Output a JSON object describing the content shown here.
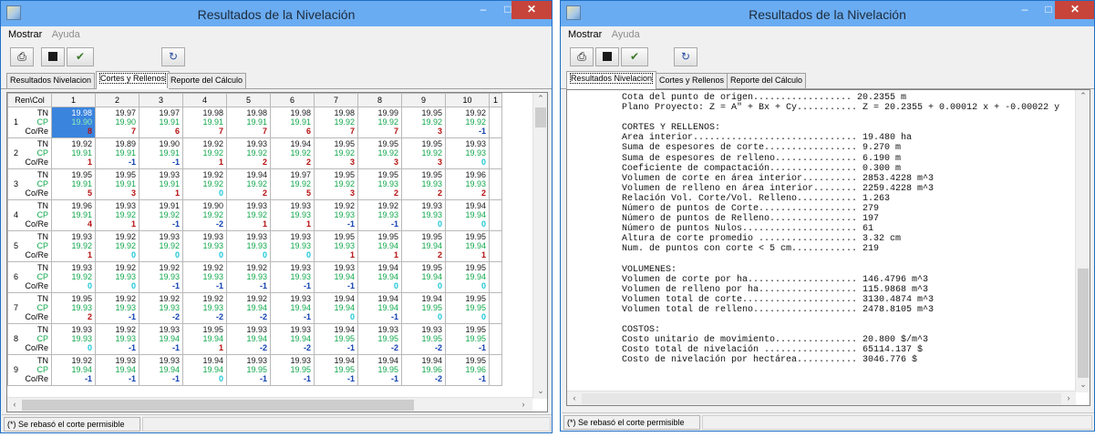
{
  "window_a": {
    "title": "Resultados de la Nivelación",
    "menu": [
      "Mostrar",
      "Ayuda"
    ],
    "toolbar": {
      "print_icon": "printer-icon",
      "save_icon": "floppy-disk-icon",
      "chart_icon": "chart-brush-icon",
      "refresh_icon": "refresh-icon"
    },
    "tabs": [
      "Resultados Nivelacion",
      "Cortes y Rellenos",
      "Reporte del Cálculo"
    ],
    "active_tab": 1,
    "grid": {
      "corner": "Ren\\Col",
      "columns": [
        "1",
        "2",
        "3",
        "4",
        "5",
        "6",
        "7",
        "8",
        "9",
        "10",
        "1"
      ],
      "row_labels": [
        "TN",
        "CP",
        "Co/Re"
      ],
      "rows": [
        {
          "n": "1",
          "tn": [
            "19.98",
            "19.97",
            "19.97",
            "19.98",
            "19.98",
            "19.98",
            "19.98",
            "19.99",
            "19.95",
            "19.92"
          ],
          "cp": [
            "19.90",
            "19.90",
            "19.91",
            "19.91",
            "19.91",
            "19.91",
            "19.92",
            "19.92",
            "19.92",
            "19.92"
          ],
          "cr": [
            "8",
            "7",
            "6",
            "7",
            "7",
            "6",
            "7",
            "7",
            "3",
            "-1"
          ]
        },
        {
          "n": "2",
          "tn": [
            "19.92",
            "19.89",
            "19.90",
            "19.92",
            "19.93",
            "19.94",
            "19.95",
            "19.95",
            "19.95",
            "19.93"
          ],
          "cp": [
            "19.91",
            "19.91",
            "19.91",
            "19.92",
            "19.92",
            "19.92",
            "19.92",
            "19.92",
            "19.92",
            "19.93"
          ],
          "cr": [
            "1",
            "-1",
            "-1",
            "1",
            "2",
            "2",
            "3",
            "3",
            "3",
            "0"
          ]
        },
        {
          "n": "3",
          "tn": [
            "19.95",
            "19.95",
            "19.93",
            "19.92",
            "19.94",
            "19.97",
            "19.95",
            "19.95",
            "19.95",
            "19.96"
          ],
          "cp": [
            "19.91",
            "19.91",
            "19.91",
            "19.92",
            "19.92",
            "19.92",
            "19.92",
            "19.93",
            "19.93",
            "19.93"
          ],
          "cr": [
            "5",
            "3",
            "1",
            "0",
            "2",
            "5",
            "3",
            "2",
            "2",
            "2"
          ]
        },
        {
          "n": "4",
          "tn": [
            "19.96",
            "19.93",
            "19.91",
            "19.90",
            "19.93",
            "19.93",
            "19.92",
            "19.92",
            "19.93",
            "19.94"
          ],
          "cp": [
            "19.91",
            "19.92",
            "19.92",
            "19.92",
            "19.92",
            "19.93",
            "19.93",
            "19.93",
            "19.93",
            "19.94"
          ],
          "cr": [
            "4",
            "1",
            "-1",
            "-2",
            "1",
            "1",
            "-1",
            "-1",
            "0",
            "0"
          ]
        },
        {
          "n": "5",
          "tn": [
            "19.93",
            "19.92",
            "19.93",
            "19.93",
            "19.93",
            "19.93",
            "19.95",
            "19.95",
            "19.95",
            "19.95"
          ],
          "cp": [
            "19.92",
            "19.92",
            "19.92",
            "19.93",
            "19.93",
            "19.93",
            "19.93",
            "19.94",
            "19.94",
            "19.94"
          ],
          "cr": [
            "1",
            "0",
            "0",
            "0",
            "0",
            "0",
            "1",
            "1",
            "2",
            "1"
          ]
        },
        {
          "n": "6",
          "tn": [
            "19.93",
            "19.92",
            "19.92",
            "19.92",
            "19.92",
            "19.93",
            "19.93",
            "19.94",
            "19.95",
            "19.95"
          ],
          "cp": [
            "19.92",
            "19.93",
            "19.93",
            "19.93",
            "19.93",
            "19.93",
            "19.94",
            "19.94",
            "19.94",
            "19.94"
          ],
          "cr": [
            "0",
            "0",
            "-1",
            "-1",
            "-1",
            "-1",
            "-1",
            "0",
            "0",
            "0"
          ]
        },
        {
          "n": "7",
          "tn": [
            "19.95",
            "19.92",
            "19.92",
            "19.92",
            "19.92",
            "19.93",
            "19.94",
            "19.94",
            "19.94",
            "19.95"
          ],
          "cp": [
            "19.93",
            "19.93",
            "19.93",
            "19.93",
            "19.94",
            "19.94",
            "19.94",
            "19.94",
            "19.95",
            "19.95"
          ],
          "cr": [
            "2",
            "-1",
            "-2",
            "-2",
            "-2",
            "-1",
            "0",
            "-1",
            "0",
            "0"
          ]
        },
        {
          "n": "8",
          "tn": [
            "19.93",
            "19.92",
            "19.93",
            "19.95",
            "19.93",
            "19.93",
            "19.94",
            "19.93",
            "19.93",
            "19.95"
          ],
          "cp": [
            "19.93",
            "19.93",
            "19.94",
            "19.94",
            "19.94",
            "19.94",
            "19.95",
            "19.95",
            "19.95",
            "19.95"
          ],
          "cr": [
            "0",
            "-1",
            "-1",
            "1",
            "-2",
            "-2",
            "-1",
            "-2",
            "-2",
            "-1"
          ]
        },
        {
          "n": "9",
          "tn": [
            "19.92",
            "19.93",
            "19.93",
            "19.94",
            "19.93",
            "19.93",
            "19.94",
            "19.94",
            "19.94",
            "19.95"
          ],
          "cp": [
            "19.94",
            "19.94",
            "19.94",
            "19.94",
            "19.95",
            "19.95",
            "19.95",
            "19.95",
            "19.96",
            "19.96"
          ],
          "cr": [
            "-1",
            "-1",
            "-1",
            "0",
            "-1",
            "-1",
            "-1",
            "-1",
            "-2",
            "-1"
          ]
        }
      ]
    },
    "status": "(*) Se rebasó el corte permisible"
  },
  "window_b": {
    "title": "Resultados de la Nivelación",
    "menu": [
      "Mostrar",
      "Ayuda"
    ],
    "tabs": [
      "Resultados Nivelacion",
      "Cortes y Rellenos",
      "Reporte del Cálculo"
    ],
    "active_tab": 0,
    "report_lines": [
      "Cota del punto de origen.................. 20.2355 m",
      "Plano Proyecto: Z = A\" + Bx + Cy........... Z = 20.2355 + 0.00012 x + -0.00022 y",
      "",
      "CORTES Y RELLENOS:",
      "Area interior.............................. 19.480 ha",
      "Suma de espesores de corte................. 9.270 m",
      "Suma de espesores de relleno............... 6.190 m",
      "Coeficiente de compactación................ 0.300 m",
      "Volumen de corte en área interior.......... 2853.4228 m^3",
      "Volumen de relleno en área interior........ 2259.4228 m^3",
      "Relación Vol. Corte/Vol. Relleno........... 1.263",
      "Número de puntos de Corte.................. 279",
      "Número de puntos de Relleno................ 197",
      "Número de puntos Nulos..................... 61",
      "Altura de corte promedio .................. 3.32 cm",
      "Num. de puntos con corte < 5 cm............ 219",
      "",
      "VOLUMENES:",
      "Volumen de corte por ha.................... 146.4796 m^3",
      "Volumen de relleno por ha.................. 115.9868 m^3",
      "Volumen total de corte..................... 3130.4874 m^3",
      "Volumen total de relleno................... 2478.8105 m^3",
      "",
      "COSTOS:",
      "Costo unitario de movimiento............... 20.800 $/m^3",
      "Costo total de nivelación ................. 65114.137 $",
      "Costo de nivelación por hectárea........... 3046.776 $"
    ],
    "status": "(*) Se rebasó el corte permisible"
  },
  "colors": {
    "titlebar": "#6aacf2",
    "close": "#c7443a",
    "cp_text": "#11a84c",
    "cut": "#b51010",
    "fill": "#0f3fb0",
    "zero": "#19c7d8",
    "selected": "#3a84de"
  }
}
